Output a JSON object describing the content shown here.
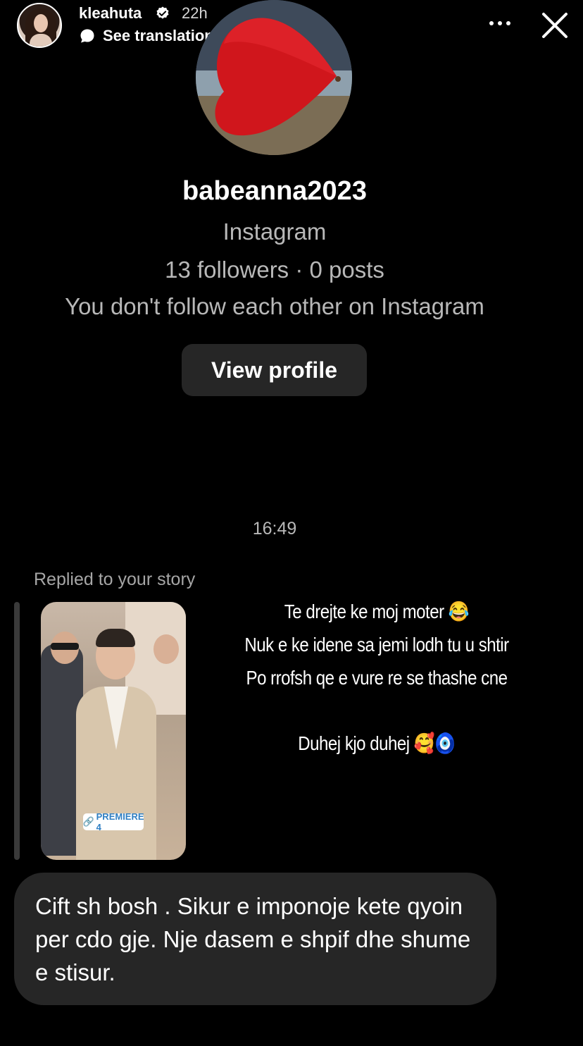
{
  "story_header": {
    "username": "kleahuta",
    "time_ago": "22h",
    "translation_label": "See translation",
    "chevron": "›",
    "avatar_icon": "user-avatar",
    "verified_icon": "verified-badge-icon",
    "more_icon": "more-horizontal-icon",
    "close_icon": "close-icon"
  },
  "profile": {
    "username": "babeanna2023",
    "platform": "Instagram",
    "stats": "13 followers · 0 posts",
    "relationship": "You don't follow each other on Instagram",
    "view_profile_label": "View profile"
  },
  "conversation": {
    "timestamp": "16:49",
    "reply_label": "Replied to your story",
    "story_thumbnail": {
      "badge_label": "PREMIERE 4"
    },
    "story_text_lines": [
      "Te drejte ke moj moter 😂",
      "Nuk e ke idene sa jemi lodh tu u shtir",
      "Po rrofsh qe e vure re se thashe cne",
      "Duhej kjo duhej 🥰🧿"
    ],
    "message": "Cift sh bosh . Sikur e imponoje kete qyoin per cdo gje. Nje dasem e shpif dhe shume e stisur."
  },
  "colors": {
    "background": "#000000",
    "card": "#262626",
    "muted_text": "#b8b8b8",
    "verified": "#ffffff"
  }
}
